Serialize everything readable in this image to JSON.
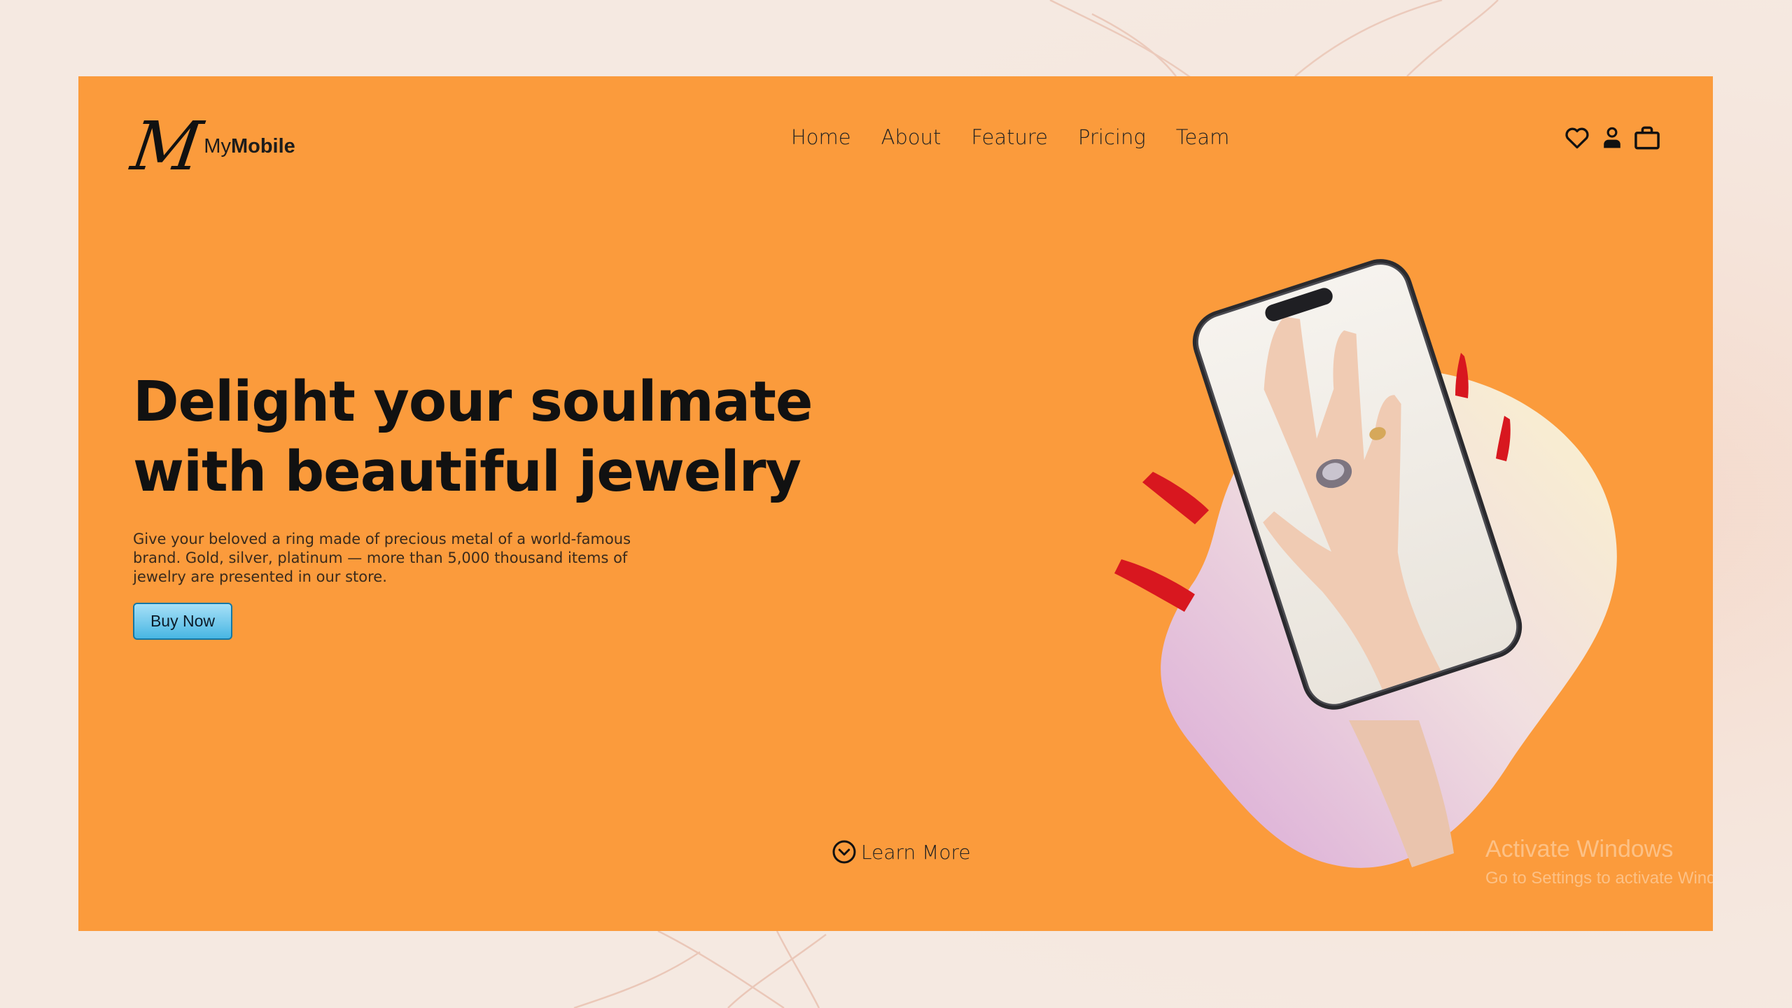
{
  "brand": {
    "logo_letter": "M",
    "name_prefix": "My",
    "name_bold": "Mobile"
  },
  "nav": {
    "items": [
      {
        "label": "Home"
      },
      {
        "label": "About"
      },
      {
        "label": "Feature"
      },
      {
        "label": "Pricing"
      },
      {
        "label": "Team"
      }
    ]
  },
  "header_icons": [
    "heart-icon",
    "user-icon",
    "shopping-bag-icon"
  ],
  "hero": {
    "title_line1": "Delight your soulmate",
    "title_line2": "with beautiful jewelry",
    "description": "Give your beloved a ring made of precious metal of a world-famous brand. Gold, silver, platinum — more than 5,000 thousand items of jewelry are presented in our store.",
    "cta_label": "Buy Now"
  },
  "learn_more": {
    "label": "Learn More",
    "icon": "chevron-down-circle-icon"
  },
  "watermark": {
    "line1": "Activate Windows",
    "line2": "Go to Settings to activate Windows."
  },
  "colors": {
    "card_background": "#fb9b3c",
    "page_background": "#f5e9e1",
    "cta_button": "#48b6e3",
    "text_dark": "#111111"
  }
}
